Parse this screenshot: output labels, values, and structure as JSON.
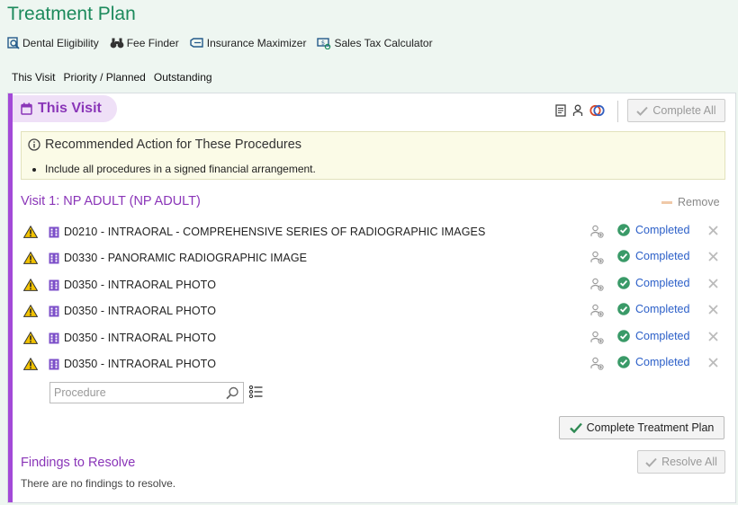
{
  "page": {
    "title": "Treatment Plan"
  },
  "tools": [
    {
      "label": "Dental Eligibility",
      "icon": "eligibility-search-icon"
    },
    {
      "label": "Fee Finder",
      "icon": "binoculars-icon"
    },
    {
      "label": "Insurance Maximizer",
      "icon": "insurance-maximizer-icon"
    },
    {
      "label": "Sales Tax Calculator",
      "icon": "tax-calculator-icon"
    }
  ],
  "tabs": [
    {
      "label": "This Visit"
    },
    {
      "label": "Priority / Planned"
    },
    {
      "label": "Outstanding"
    }
  ],
  "visit_panel": {
    "title": "This Visit",
    "complete_all_label": "Complete All",
    "header_icons": [
      "notes-icon",
      "provider-icon",
      "linked-circles-icon"
    ]
  },
  "recommendation": {
    "title": "Recommended Action for These Procedures",
    "items": [
      "Include all procedures in a signed financial arrangement."
    ]
  },
  "visit": {
    "heading": "Visit 1: NP ADULT (NP ADULT)",
    "remove_label": "Remove",
    "procedures": [
      {
        "text": "D0210 - INTRAORAL - COMPREHENSIVE SERIES OF RADIOGRAPHIC IMAGES",
        "status": "Completed"
      },
      {
        "text": "D0330 - PANORAMIC RADIOGRAPHIC IMAGE",
        "status": "Completed"
      },
      {
        "text": "D0350 - INTRAORAL PHOTO",
        "status": "Completed"
      },
      {
        "text": "D0350 - INTRAORAL PHOTO",
        "status": "Completed"
      },
      {
        "text": "D0350 - INTRAORAL PHOTO",
        "status": "Completed"
      },
      {
        "text": "D0350 - INTRAORAL PHOTO",
        "status": "Completed"
      }
    ],
    "procedure_input": {
      "placeholder": "Procedure",
      "value": ""
    },
    "complete_plan_label": "Complete Treatment Plan"
  },
  "findings": {
    "heading": "Findings to Resolve",
    "resolve_all_label": "Resolve All",
    "empty_text": "There are no findings to resolve."
  },
  "colors": {
    "title_green": "#1c8a5c",
    "accent_purple": "#a349d8",
    "heading_purple": "#8a35b8",
    "status_blue": "#2b5fc8",
    "check_green": "#3a9a68",
    "warning_yellow": "#f2c200",
    "alert_bg": "#fbfbe7"
  }
}
